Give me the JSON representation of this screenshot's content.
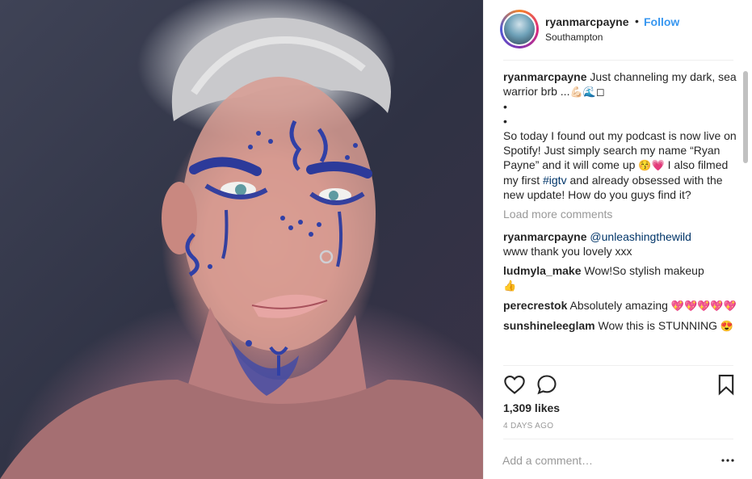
{
  "header": {
    "username": "ryanmarcpayne",
    "dot": "•",
    "follow_label": "Follow",
    "location": "Southampton"
  },
  "caption": {
    "username": "ryanmarcpayne",
    "line1": "Just channeling my dark, sea warrior brb ...",
    "line1_emoji": "💪🏻🌊◻",
    "bullet1": "•",
    "bullet2": "•",
    "body_a": "So today I found out my podcast is now live on Spotify! Just simply search my name “Ryan Payne” and it will come up ",
    "body_a_emoji": "😚💗",
    "body_b": " I also filmed my first ",
    "hashtag": "#igtv",
    "body_c": " and already obsessed with the new update! How do you guys find it?"
  },
  "load_more_label": "Load more comments",
  "comments": [
    {
      "username": "ryanmarcpayne",
      "mention": "@unleashingthewild",
      "text": "www thank you lovely xxx"
    },
    {
      "username": "ludmyla_make",
      "text": "Wow!So stylish makeup",
      "emoji": "👍"
    },
    {
      "username": "perecrestok",
      "text": "Absolutely amazing",
      "emoji": "💖💖💖💖💖"
    },
    {
      "username": "sunshineleeglam",
      "text": "Wow this is STUNNING",
      "emoji": "😍"
    }
  ],
  "likes_label": "1,309 likes",
  "date_label": "4 DAYS AGO",
  "add_comment_placeholder": "Add a comment…",
  "icons": {
    "like": "heart-outline",
    "comment": "speech-bubble-outline",
    "save": "bookmark-outline",
    "more": "three-dots"
  },
  "colors": {
    "follow": "#3897f0",
    "muted": "#999999",
    "text": "#262626",
    "link": "#003569"
  }
}
